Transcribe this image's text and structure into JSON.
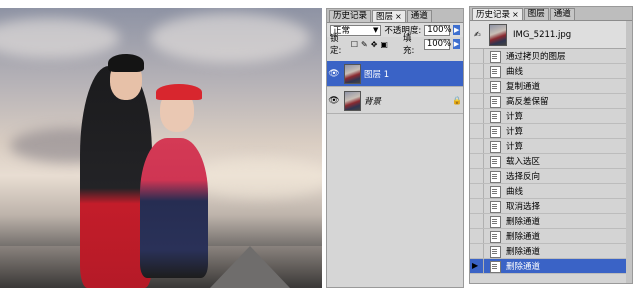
{
  "layers_panel": {
    "tabs": [
      {
        "label": "历史记录",
        "active": false
      },
      {
        "label": "图层",
        "active": true,
        "close": "×"
      },
      {
        "label": "通道",
        "active": false
      }
    ],
    "blend_mode": "正常",
    "opacity_label": "不透明度:",
    "opacity_value": "100%",
    "lock_label": "锁定:",
    "fill_label": "填充:",
    "fill_value": "100%",
    "layers": [
      {
        "name": "图层 1",
        "selected": true,
        "visible": true
      },
      {
        "name": "背景",
        "selected": false,
        "visible": true,
        "locked": true
      }
    ]
  },
  "history_panel": {
    "tabs": [
      {
        "label": "历史记录",
        "active": true,
        "close": "×"
      },
      {
        "label": "图层",
        "active": false
      },
      {
        "label": "通道",
        "active": false
      }
    ],
    "snapshot": "IMG_5211.jpg",
    "steps": [
      "通过拷贝的图层",
      "曲线",
      "复制通道",
      "高反差保留",
      "计算",
      "计算",
      "计算",
      "载入选区",
      "选择反向",
      "曲线",
      "取消选择",
      "删除通道",
      "删除通道",
      "删除通道",
      "删除通道"
    ],
    "selected_step_index": 14
  },
  "colors": {
    "selection": "#3a63c6",
    "panel_bg": "#d6d6d6"
  }
}
